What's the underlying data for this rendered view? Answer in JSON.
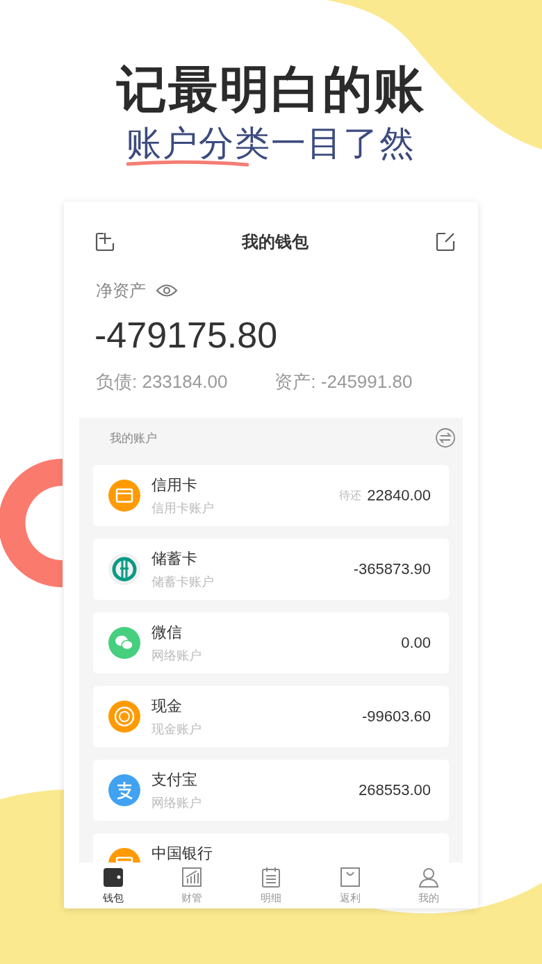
{
  "headline": "记最明白的账",
  "subtitle": "账户分类一目了然",
  "wallet": {
    "title": "我的钱包",
    "net_label": "净资产",
    "net_value": "-479175.80",
    "liabilities": "负债: 233184.00",
    "assets": "资产: -245991.80"
  },
  "accounts_section": {
    "title": "我的账户"
  },
  "accounts": [
    {
      "name": "信用卡",
      "type": "信用卡账户",
      "amount_label": "待还",
      "amount": "22840.00",
      "kind": "card",
      "color": "#ff9a00"
    },
    {
      "name": "储蓄卡",
      "type": "储蓄卡账户",
      "amount": "-365873.90",
      "kind": "bank",
      "color": "#079b84"
    },
    {
      "name": "微信",
      "type": "网络账户",
      "amount": "0.00",
      "kind": "wechat",
      "color": "#45cf7e"
    },
    {
      "name": "现金",
      "type": "现金账户",
      "amount": "-99603.60",
      "kind": "cash",
      "color": "#ff9a00"
    },
    {
      "name": "支付宝",
      "type": "网络账户",
      "amount": "268553.00",
      "kind": "alipay",
      "color": "#42a2f2"
    },
    {
      "name": "中国银行",
      "kind": "card",
      "color": "#ff9a00"
    }
  ],
  "tabs": [
    {
      "label": "钱包",
      "kind": "wallet",
      "selected": true
    },
    {
      "label": "财管",
      "kind": "chart",
      "selected": false
    },
    {
      "label": "明细",
      "kind": "notepad",
      "selected": false
    },
    {
      "label": "返利",
      "kind": "bag",
      "selected": false
    },
    {
      "label": "我的",
      "kind": "person",
      "selected": false
    }
  ]
}
